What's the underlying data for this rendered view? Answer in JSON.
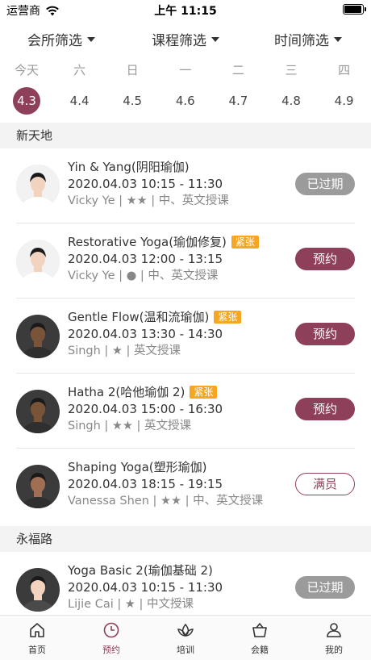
{
  "status": {
    "carrier": "运营商",
    "time": "上午 11:15",
    "battery_level": 0.95
  },
  "filters": [
    "会所筛选",
    "课程筛选",
    "时间筛选"
  ],
  "week": [
    {
      "wk": "今天",
      "date": "4.3",
      "active": true
    },
    {
      "wk": "六",
      "date": "4.4"
    },
    {
      "wk": "日",
      "date": "4.5"
    },
    {
      "wk": "一",
      "date": "4.6"
    },
    {
      "wk": "二",
      "date": "4.7"
    },
    {
      "wk": "三",
      "date": "4.8"
    },
    {
      "wk": "四",
      "date": "4.9"
    }
  ],
  "sections": [
    {
      "name": "新天地",
      "classes": [
        {
          "title": "Yin & Yang(阴阳瑜伽)",
          "tag": "",
          "time": "2020.04.03 10:15 - 11:30",
          "meta": "Vicky Ye | ★★ | 中、英文授课",
          "button": "已过期",
          "button_type": "expired",
          "avatar": "woman"
        },
        {
          "title": "Restorative Yoga(瑜伽修复)",
          "tag": "紧张",
          "time": "2020.04.03 12:00 - 13:15",
          "meta": "Vicky Ye | ● | 中、英文授课",
          "button": "预约",
          "button_type": "book",
          "avatar": "woman"
        },
        {
          "title": "Gentle Flow(温和流瑜伽)",
          "tag": "紧张",
          "time": "2020.04.03 13:30 - 14:30",
          "meta": "Singh | ★ | 英文授课",
          "button": "预约",
          "button_type": "book",
          "avatar": "man-dark"
        },
        {
          "title": "Hatha 2(哈他瑜伽 2)",
          "tag": "紧张",
          "time": "2020.04.03 15:00 - 16:30",
          "meta": "Singh | ★★ | 英文授课",
          "button": "预约",
          "button_type": "book",
          "avatar": "man-dark"
        },
        {
          "title": "Shaping Yoga(塑形瑜伽)",
          "tag": "",
          "time": "2020.04.03 18:15 - 19:15",
          "meta": "Vanessa Shen | ★★ | 中、英文授课",
          "button": "满员",
          "button_type": "full",
          "avatar": "woman-dark"
        }
      ]
    },
    {
      "name": "永福路",
      "classes": [
        {
          "title": "Yoga Basic 2(瑜伽基础 2)",
          "tag": "",
          "time": "2020.04.03 10:15 - 11:30",
          "meta": "Lijie Cai | ★ | 中文授课",
          "button": "已过期",
          "button_type": "expired",
          "avatar": "man"
        }
      ]
    }
  ],
  "tabbar": [
    {
      "label": "首页",
      "icon": "home-icon"
    },
    {
      "label": "预约",
      "icon": "clock-icon",
      "active": true
    },
    {
      "label": "培训",
      "icon": "lotus-icon"
    },
    {
      "label": "会籍",
      "icon": "basket-icon"
    },
    {
      "label": "我的",
      "icon": "person-icon"
    }
  ],
  "colors": {
    "accent": "#8e3f5a",
    "tag": "#f5a623",
    "expired": "#9b9b9b"
  }
}
